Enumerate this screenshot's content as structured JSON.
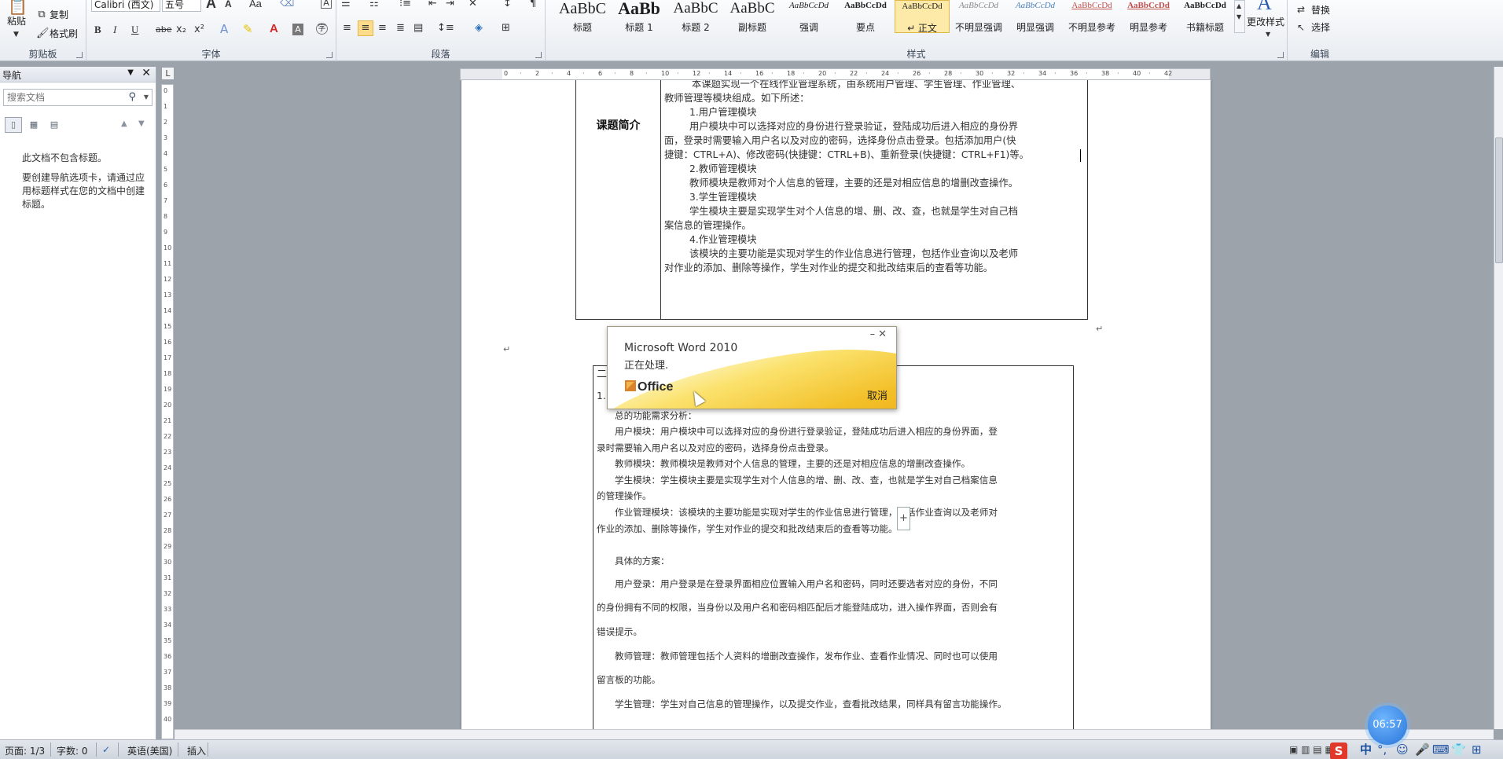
{
  "ribbon": {
    "clipboard": {
      "group": "剪贴板",
      "paste": "粘贴",
      "copy": "复制",
      "format_painter": "格式刷"
    },
    "font": {
      "group": "字体",
      "font_name": "Calibri (西文)",
      "font_size": "五号",
      "bold": "B",
      "italic": "I",
      "underline": "U",
      "strike": "abe",
      "subscript": "x₂",
      "superscript": "x²",
      "big_a": "A",
      "small_a": "A",
      "case": "Aa"
    },
    "paragraph": {
      "group": "段落"
    },
    "styles": {
      "group": "样式",
      "items": [
        {
          "preview": "AaBbC",
          "name": "标题"
        },
        {
          "preview": "AaBb",
          "name": "标题 1"
        },
        {
          "preview": "AaBbC",
          "name": "标题 2"
        },
        {
          "preview": "AaBbC",
          "name": "副标题"
        },
        {
          "preview": "AaBbCcDd",
          "name": "强调"
        },
        {
          "preview": "AaBbCcDd",
          "name": "要点"
        },
        {
          "preview": "AaBbCcDd",
          "name": "↵ 正文"
        },
        {
          "preview": "AaBbCcDd",
          "name": "不明显强调"
        },
        {
          "preview": "AaBbCcDd",
          "name": "明显强调"
        },
        {
          "preview": "AaBbCcDd",
          "name": "不明显参考"
        },
        {
          "preview": "AaBbCcDd",
          "name": "明显参考"
        },
        {
          "preview": "AaBbCcDd",
          "name": "书籍标题"
        }
      ],
      "change_styles": "更改样式"
    },
    "editing": {
      "group": "编辑",
      "replace": "替换",
      "select": "选择"
    }
  },
  "navigation": {
    "title": "导航",
    "search_placeholder": "搜索文档",
    "msg1": "此文档不包含标题。",
    "msg2": "要创建导航选项卡，请通过应用标题样式在您的文档中创建标题。"
  },
  "document": {
    "table1_label": "课题简介",
    "table1_lines": [
      "本课题实现一个在线作业管理系统，由系统用户管理、学生管理、作业管理、",
      "教师管理等模块组成。如下所述：",
      "1.用户管理模块",
      "用户模块中可以选择对应的身份进行登录验证，登陆成功后进入相应的身份界",
      "面，登录时需要输入用户名以及对应的密码，选择身份点击登录。包括添加用户(快",
      "捷键：CTRL+A)、修改密码(快捷键：CTRL+B)、重新登录(快捷键：CTRL+F1)等。",
      "2.教师管理模块",
      "教师模块是教师对个人信息的管理，主要的还是对相应信息的增删改查操作。",
      "3.学生管理模块",
      "学生模块主要是实现学生对个人信息的增、删、改、查，也就是学生对自己档",
      "案信息的管理操作。",
      "4.作业管理模块",
      "该模块的主要功能是实现对学生的作业信息进行管理，包括作业查询以及老师",
      "对作业的添加、删除等操作，学生对作业的提交和批改结束后的查看等功能。"
    ],
    "table2_lines": [
      "总的功能需求分析：",
      "用户模块：用户模块中可以选择对应的身份进行登录验证，登陆成功后进入相应的身份界面，登",
      "录时需要输入用户名以及对应的密码，选择身份点击登录。",
      "教师模块：教师模块是教师对个人信息的管理，主要的还是对相应信息的增删改查操作。",
      "学生模块：学生模块主要是实现学生对个人信息的增、删、改、查，也就是学生对自己档案信息",
      "的管理操作。",
      "作业管理模块：该模块的主要功能是实现对学生的作业信息进行管理，包括作业查询以及老师对",
      "作业的添加、删除等操作，学生对作业的提交和批改结束后的查看等功能。",
      "具体的方案：",
      "用户登录：用户登录是在登录界面相应位置输入用户名和密码，同时还要选者对应的身份，不同",
      "的身份拥有不同的权限，当身份以及用户名和密码相匹配后才能登陆成功，进入操作界面，否则会有",
      "错误提示。",
      "教师管理：教师管理包括个人资料的增删改查操作，发布作业、查看作业情况、同时也可以使用",
      "留言板的功能。",
      "学生管理：学生对自己信息的管理操作，以及提交作业，查看批改结果，同样具有留言功能操作。"
    ],
    "table2_num": "1.",
    "table2_head": "二"
  },
  "dialog": {
    "title": "Microsoft Word 2010",
    "message": "正在处理.",
    "logo": "Office",
    "cancel": "取消"
  },
  "status": {
    "page": "页面: 1/3",
    "words": "字数: 0",
    "language": "英语(美国)",
    "mode": "插入"
  },
  "timer": "06:57"
}
